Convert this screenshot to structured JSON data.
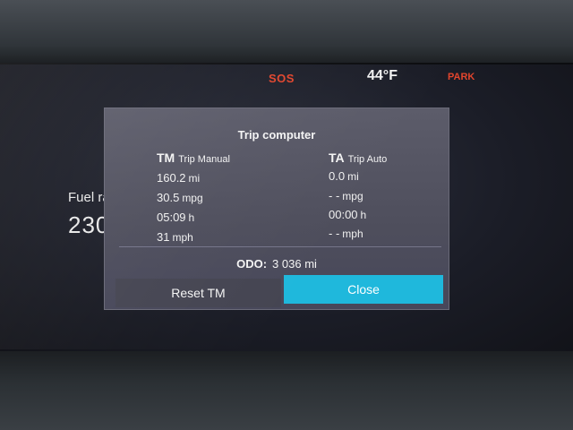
{
  "status_bar": {
    "sos_label": "SOS",
    "temperature": "44°F",
    "gear": "PARK"
  },
  "background": {
    "fuel_label": "Fuel range",
    "fuel_value": "230"
  },
  "trip_dialog": {
    "title": "Trip computer",
    "trip_manual": {
      "abbr": "TM",
      "name": "Trip Manual",
      "distance": {
        "value": "160.2",
        "unit": "mi"
      },
      "consumption": {
        "value": "30.5",
        "unit": "mpg"
      },
      "time": {
        "value": "05:09",
        "unit": "h"
      },
      "speed": {
        "value": "31",
        "unit": "mph"
      }
    },
    "trip_auto": {
      "abbr": "TA",
      "name": "Trip Auto",
      "distance": {
        "value": "0.0",
        "unit": "mi"
      },
      "consumption": {
        "value": "- -",
        "unit": "mpg"
      },
      "time": {
        "value": "00:00",
        "unit": "h"
      },
      "speed": {
        "value": "- -",
        "unit": "mph"
      }
    },
    "odometer": {
      "label": "ODO:",
      "value": "3 036",
      "unit": "mi"
    },
    "reset_button_label": "Reset TM",
    "close_button_label": "Close"
  },
  "colors": {
    "alert_red": "#e2452d",
    "close_button": "#1fb8dc",
    "dialog_bg": "#52525f"
  }
}
